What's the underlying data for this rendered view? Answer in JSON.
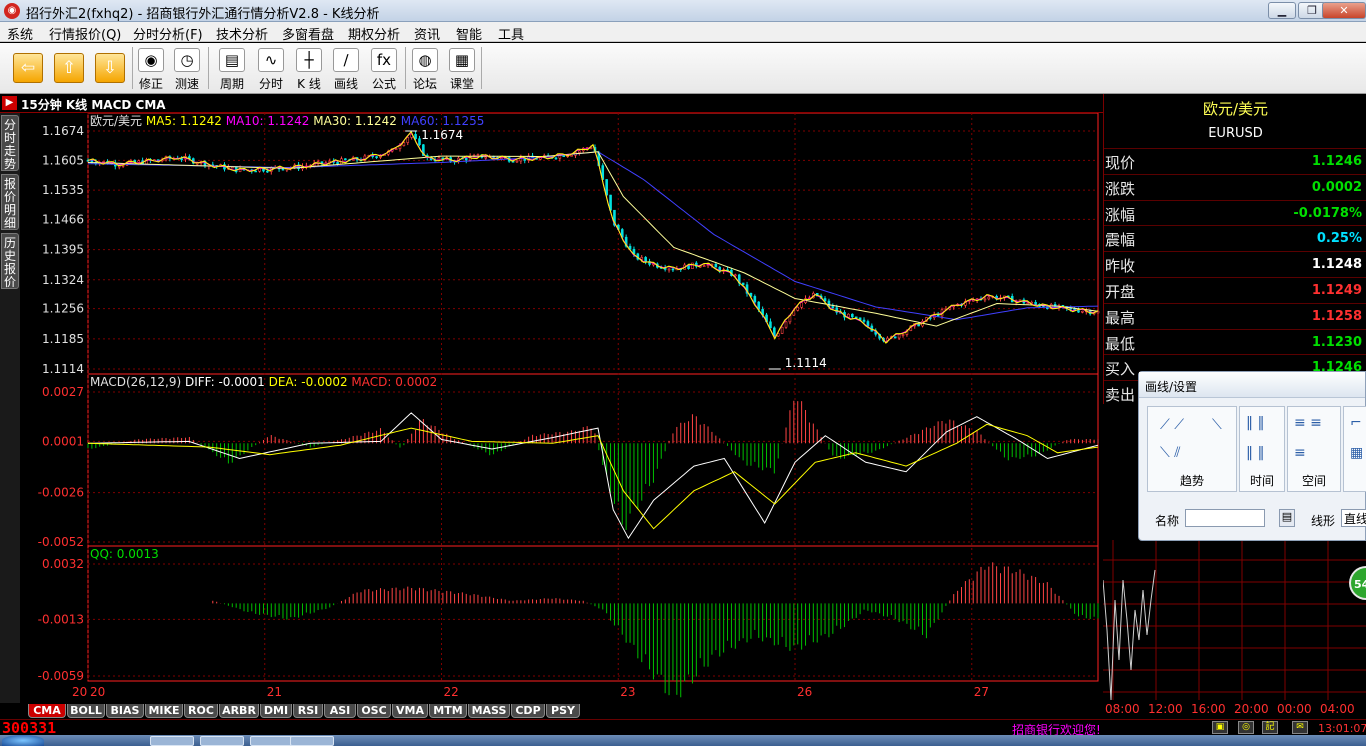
{
  "window": {
    "title": "招行外汇2(fxhq2) - 招商银行外汇通行情分析V2.8 - K线分析",
    "buttons": [
      "▁",
      "❐",
      "✕"
    ]
  },
  "menu": [
    "系统",
    "行情报价(Q)",
    "分时分析(F)",
    "技术分析",
    "多窗看盘",
    "期权分析",
    "资讯",
    "智能",
    "工具"
  ],
  "toolbar": {
    "arrows": [
      "⇦",
      "⇧",
      "⇩"
    ],
    "buttons": [
      {
        "label": "修正",
        "glyph": "◉"
      },
      {
        "label": "测速",
        "glyph": "◷"
      },
      {
        "label": "周期",
        "glyph": "▤"
      },
      {
        "label": "分时",
        "glyph": "∿"
      },
      {
        "label": "K 线",
        "glyph": "┼"
      },
      {
        "label": "画线",
        "glyph": "∕"
      },
      {
        "label": "公式",
        "glyph": "fx"
      },
      {
        "label": "论坛",
        "glyph": "◍"
      },
      {
        "label": "课堂",
        "glyph": "▦"
      }
    ]
  },
  "chart_header": "15分钟 K线 MACD CMA",
  "left_tabs": [
    "分时走势",
    "报价明细",
    "历史报价"
  ],
  "colors": {
    "ma5": "#ffff00",
    "ma10": "#ff00ff",
    "ma30": "#ffff99",
    "ma60": "#4040ff",
    "up": "#ff4444",
    "down": "#00c000",
    "grid": "#800000",
    "axis": "#ff2020"
  },
  "chart_data": [
    {
      "type": "line",
      "subtype": "candlestick-kline",
      "legend_symbol": "欧元/美元",
      "series": [
        {
          "name": "MA5",
          "label": "MA5: 1.1242"
        },
        {
          "name": "MA10",
          "label": "MA10: 1.1242"
        },
        {
          "name": "MA30",
          "label": "MA30: 1.1242"
        },
        {
          "name": "MA60",
          "label": "MA60: 1.1255"
        }
      ],
      "ylim": [
        1.1114,
        1.1674
      ],
      "yticks": [
        "1.1674",
        "1.1605",
        "1.1535",
        "1.1466",
        "1.1395",
        "1.1324",
        "1.1256",
        "1.1185",
        "1.1114"
      ],
      "annotations": [
        {
          "text": "1.1674",
          "x": 0.32
        },
        {
          "text": "1.1114",
          "x": 0.68
        }
      ],
      "price": [
        [
          0,
          1.1605
        ],
        [
          0.03,
          1.1596
        ],
        [
          0.06,
          1.1603
        ],
        [
          0.09,
          1.1612
        ],
        [
          0.12,
          1.1595
        ],
        [
          0.15,
          1.1582
        ],
        [
          0.18,
          1.1585
        ],
        [
          0.21,
          1.159
        ],
        [
          0.24,
          1.16
        ],
        [
          0.27,
          1.1608
        ],
        [
          0.3,
          1.1625
        ],
        [
          0.32,
          1.1668
        ],
        [
          0.335,
          1.161
        ],
        [
          0.36,
          1.1605
        ],
        [
          0.39,
          1.1615
        ],
        [
          0.42,
          1.1608
        ],
        [
          0.45,
          1.161
        ],
        [
          0.48,
          1.1622
        ],
        [
          0.5,
          1.164
        ],
        [
          0.505,
          1.16
        ],
        [
          0.52,
          1.146
        ],
        [
          0.54,
          1.138
        ],
        [
          0.56,
          1.136
        ],
        [
          0.58,
          1.135
        ],
        [
          0.61,
          1.1362
        ],
        [
          0.64,
          1.1335
        ],
        [
          0.66,
          1.127
        ],
        [
          0.68,
          1.119
        ],
        [
          0.7,
          1.126
        ],
        [
          0.72,
          1.129
        ],
        [
          0.74,
          1.125
        ],
        [
          0.77,
          1.122
        ],
        [
          0.79,
          1.118
        ],
        [
          0.81,
          1.1205
        ],
        [
          0.83,
          1.123
        ],
        [
          0.86,
          1.1265
        ],
        [
          0.89,
          1.1285
        ],
        [
          0.91,
          1.128
        ],
        [
          0.94,
          1.1265
        ],
        [
          0.97,
          1.1255
        ],
        [
          1.0,
          1.1248
        ]
      ],
      "ma60": [
        [
          0,
          1.1597
        ],
        [
          0.2,
          1.1588
        ],
        [
          0.35,
          1.16
        ],
        [
          0.45,
          1.1612
        ],
        [
          0.505,
          1.1625
        ],
        [
          0.55,
          1.156
        ],
        [
          0.62,
          1.143
        ],
        [
          0.7,
          1.132
        ],
        [
          0.78,
          1.126
        ],
        [
          0.86,
          1.123
        ],
        [
          0.93,
          1.1258
        ],
        [
          1.0,
          1.1262
        ]
      ],
      "ma30": [
        [
          0,
          1.16
        ],
        [
          0.2,
          1.1586
        ],
        [
          0.35,
          1.1615
        ],
        [
          0.45,
          1.1614
        ],
        [
          0.505,
          1.1625
        ],
        [
          0.53,
          1.152
        ],
        [
          0.58,
          1.14
        ],
        [
          0.65,
          1.134
        ],
        [
          0.7,
          1.128
        ],
        [
          0.78,
          1.1245
        ],
        [
          0.84,
          1.1215
        ],
        [
          0.9,
          1.1268
        ],
        [
          0.96,
          1.1262
        ],
        [
          1.0,
          1.125
        ]
      ]
    },
    {
      "type": "bar",
      "name": "MACD",
      "legend": {
        "prefix": "MACD(26,12,9)",
        "diff": "DIFF: -0.0001",
        "dea": "DEA: -0.0002",
        "macd": "MACD: 0.0002"
      },
      "ylim": [
        -0.0052,
        0.0027
      ],
      "yticks": [
        "0.0027",
        "0.0001",
        "-0.0026",
        "-0.0052"
      ],
      "hist": [
        [
          0,
          -0.0003
        ],
        [
          0.05,
          0.0002
        ],
        [
          0.1,
          0.0003
        ],
        [
          0.14,
          -0.001
        ],
        [
          0.18,
          0.0004
        ],
        [
          0.22,
          -0.0002
        ],
        [
          0.26,
          0.0003
        ],
        [
          0.29,
          0.0007
        ],
        [
          0.31,
          -0.0003
        ],
        [
          0.33,
          0.0012
        ],
        [
          0.36,
          0.0003
        ],
        [
          0.4,
          -0.0006
        ],
        [
          0.44,
          0.0004
        ],
        [
          0.48,
          0.0006
        ],
        [
          0.5,
          0.0009
        ],
        [
          0.51,
          -0.0012
        ],
        [
          0.53,
          -0.0042
        ],
        [
          0.56,
          -0.0018
        ],
        [
          0.58,
          0.0007
        ],
        [
          0.6,
          0.0014
        ],
        [
          0.62,
          0.0005
        ],
        [
          0.65,
          -0.001
        ],
        [
          0.68,
          -0.0014
        ],
        [
          0.7,
          0.0025
        ],
        [
          0.72,
          0.0008
        ],
        [
          0.74,
          -0.0008
        ],
        [
          0.78,
          -0.0004
        ],
        [
          0.82,
          0.0005
        ],
        [
          0.85,
          0.0012
        ],
        [
          0.88,
          0.0006
        ],
        [
          0.91,
          -0.0008
        ],
        [
          0.94,
          -0.0006
        ],
        [
          0.97,
          0.0002
        ],
        [
          1.0,
          0.0002
        ]
      ],
      "diff": [
        [
          0,
          0.0
        ],
        [
          0.1,
          0.0001
        ],
        [
          0.15,
          -0.0008
        ],
        [
          0.22,
          0.0
        ],
        [
          0.29,
          0.0001
        ],
        [
          0.32,
          0.0016
        ],
        [
          0.35,
          0.0002
        ],
        [
          0.4,
          -0.0003
        ],
        [
          0.46,
          0.0003
        ],
        [
          0.505,
          0.0008
        ],
        [
          0.52,
          -0.0035
        ],
        [
          0.535,
          -0.005
        ],
        [
          0.56,
          -0.003
        ],
        [
          0.6,
          -0.0012
        ],
        [
          0.63,
          -0.0008
        ],
        [
          0.67,
          -0.0042
        ],
        [
          0.7,
          -0.001
        ],
        [
          0.73,
          0.0004
        ],
        [
          0.77,
          -0.001
        ],
        [
          0.81,
          -0.0015
        ],
        [
          0.85,
          0.0006
        ],
        [
          0.88,
          0.0014
        ],
        [
          0.92,
          0.0002
        ],
        [
          0.95,
          -0.0008
        ],
        [
          1.0,
          -0.0001
        ]
      ],
      "dea": [
        [
          0,
          0.0
        ],
        [
          0.12,
          -0.0002
        ],
        [
          0.18,
          -0.0006
        ],
        [
          0.25,
          -0.0001
        ],
        [
          0.32,
          0.0008
        ],
        [
          0.38,
          0.0001
        ],
        [
          0.46,
          0.0
        ],
        [
          0.505,
          0.0004
        ],
        [
          0.53,
          -0.0025
        ],
        [
          0.56,
          -0.0045
        ],
        [
          0.6,
          -0.0025
        ],
        [
          0.64,
          -0.0015
        ],
        [
          0.68,
          -0.0032
        ],
        [
          0.72,
          -0.001
        ],
        [
          0.76,
          -0.0005
        ],
        [
          0.81,
          -0.0012
        ],
        [
          0.86,
          0.0
        ],
        [
          0.89,
          0.001
        ],
        [
          0.93,
          0.0004
        ],
        [
          0.96,
          -0.0005
        ],
        [
          1.0,
          -0.0002
        ]
      ]
    },
    {
      "type": "bar",
      "name": "QQ",
      "legend": "QQ: 0.0013",
      "ylim": [
        -0.0059,
        0.0032
      ],
      "yticks": [
        "0.0032",
        "-0.0013",
        "-0.0059"
      ],
      "start": 0.12,
      "hist": [
        [
          0.12,
          0.0003
        ],
        [
          0.16,
          -0.0007
        ],
        [
          0.2,
          -0.0012
        ],
        [
          0.24,
          -0.0003
        ],
        [
          0.27,
          0.001
        ],
        [
          0.32,
          0.0012
        ],
        [
          0.38,
          0.0007
        ],
        [
          0.42,
          0.0002
        ],
        [
          0.46,
          0.0004
        ],
        [
          0.49,
          0.0002
        ],
        [
          0.51,
          -0.0005
        ],
        [
          0.55,
          -0.0045
        ],
        [
          0.58,
          -0.0072
        ],
        [
          0.62,
          -0.004
        ],
        [
          0.66,
          -0.0025
        ],
        [
          0.7,
          -0.0035
        ],
        [
          0.74,
          -0.0022
        ],
        [
          0.77,
          -0.0005
        ],
        [
          0.8,
          -0.0012
        ],
        [
          0.83,
          -0.0025
        ],
        [
          0.86,
          0.001
        ],
        [
          0.89,
          0.003
        ],
        [
          0.92,
          0.0025
        ],
        [
          0.95,
          0.0015
        ],
        [
          0.98,
          -0.001
        ],
        [
          1.0,
          -0.0012
        ]
      ]
    }
  ],
  "xaxis_labels": [
    {
      "t": "20",
      "x": 0.0
    },
    {
      "t": "21",
      "x": 0.175
    },
    {
      "t": "22",
      "x": 0.35
    },
    {
      "t": "23",
      "x": 0.525
    },
    {
      "t": "26",
      "x": 0.7
    },
    {
      "t": "27",
      "x": 0.875
    }
  ],
  "xaxis_first": "20",
  "right_panel": {
    "symbol": "欧元/美元",
    "code": "EURUSD",
    "rows": [
      {
        "label": "现价",
        "value": "1.1246",
        "color": "#00e000"
      },
      {
        "label": "涨跌",
        "value": "0.0002",
        "color": "#00e000"
      },
      {
        "label": "涨幅",
        "value": "-0.0178%",
        "color": "#00e000"
      },
      {
        "label": "震幅",
        "value": "0.25%",
        "color": "#00e0ff"
      },
      {
        "label": "昨收",
        "value": "1.1248",
        "color": "#ffffff"
      },
      {
        "label": "开盘",
        "value": "1.1249",
        "color": "#ff3030"
      },
      {
        "label": "最高",
        "value": "1.1258",
        "color": "#ff3030"
      },
      {
        "label": "最低",
        "value": "1.1230",
        "color": "#00e000"
      },
      {
        "label": "买入",
        "value": "1.1246",
        "color": "#00e000"
      },
      {
        "label": "卖出",
        "value": "",
        "color": "#00e000"
      }
    ]
  },
  "mini_chart": {
    "xlabels": [
      "08:00",
      "12:00",
      "16:00",
      "20:00",
      "00:00",
      "04:00"
    ]
  },
  "draw_dialog": {
    "title": "画线/设置",
    "groups": [
      "趋势",
      "时间",
      "空间"
    ],
    "name_label": "名称",
    "linetype_label": "线形",
    "linetype_value": "直线"
  },
  "bottom_tabs": [
    "CMA",
    "BOLL",
    "BIAS",
    "MIKE",
    "ROC",
    "ARBR",
    "DMI",
    "RSI",
    "ASI",
    "OSC",
    "VMA",
    "MTM",
    "MASS",
    "CDP",
    "PSY"
  ],
  "status": {
    "code": "300331",
    "welcome": "招商银行欢迎您!",
    "time": "13:01:07",
    "badge": "54"
  }
}
